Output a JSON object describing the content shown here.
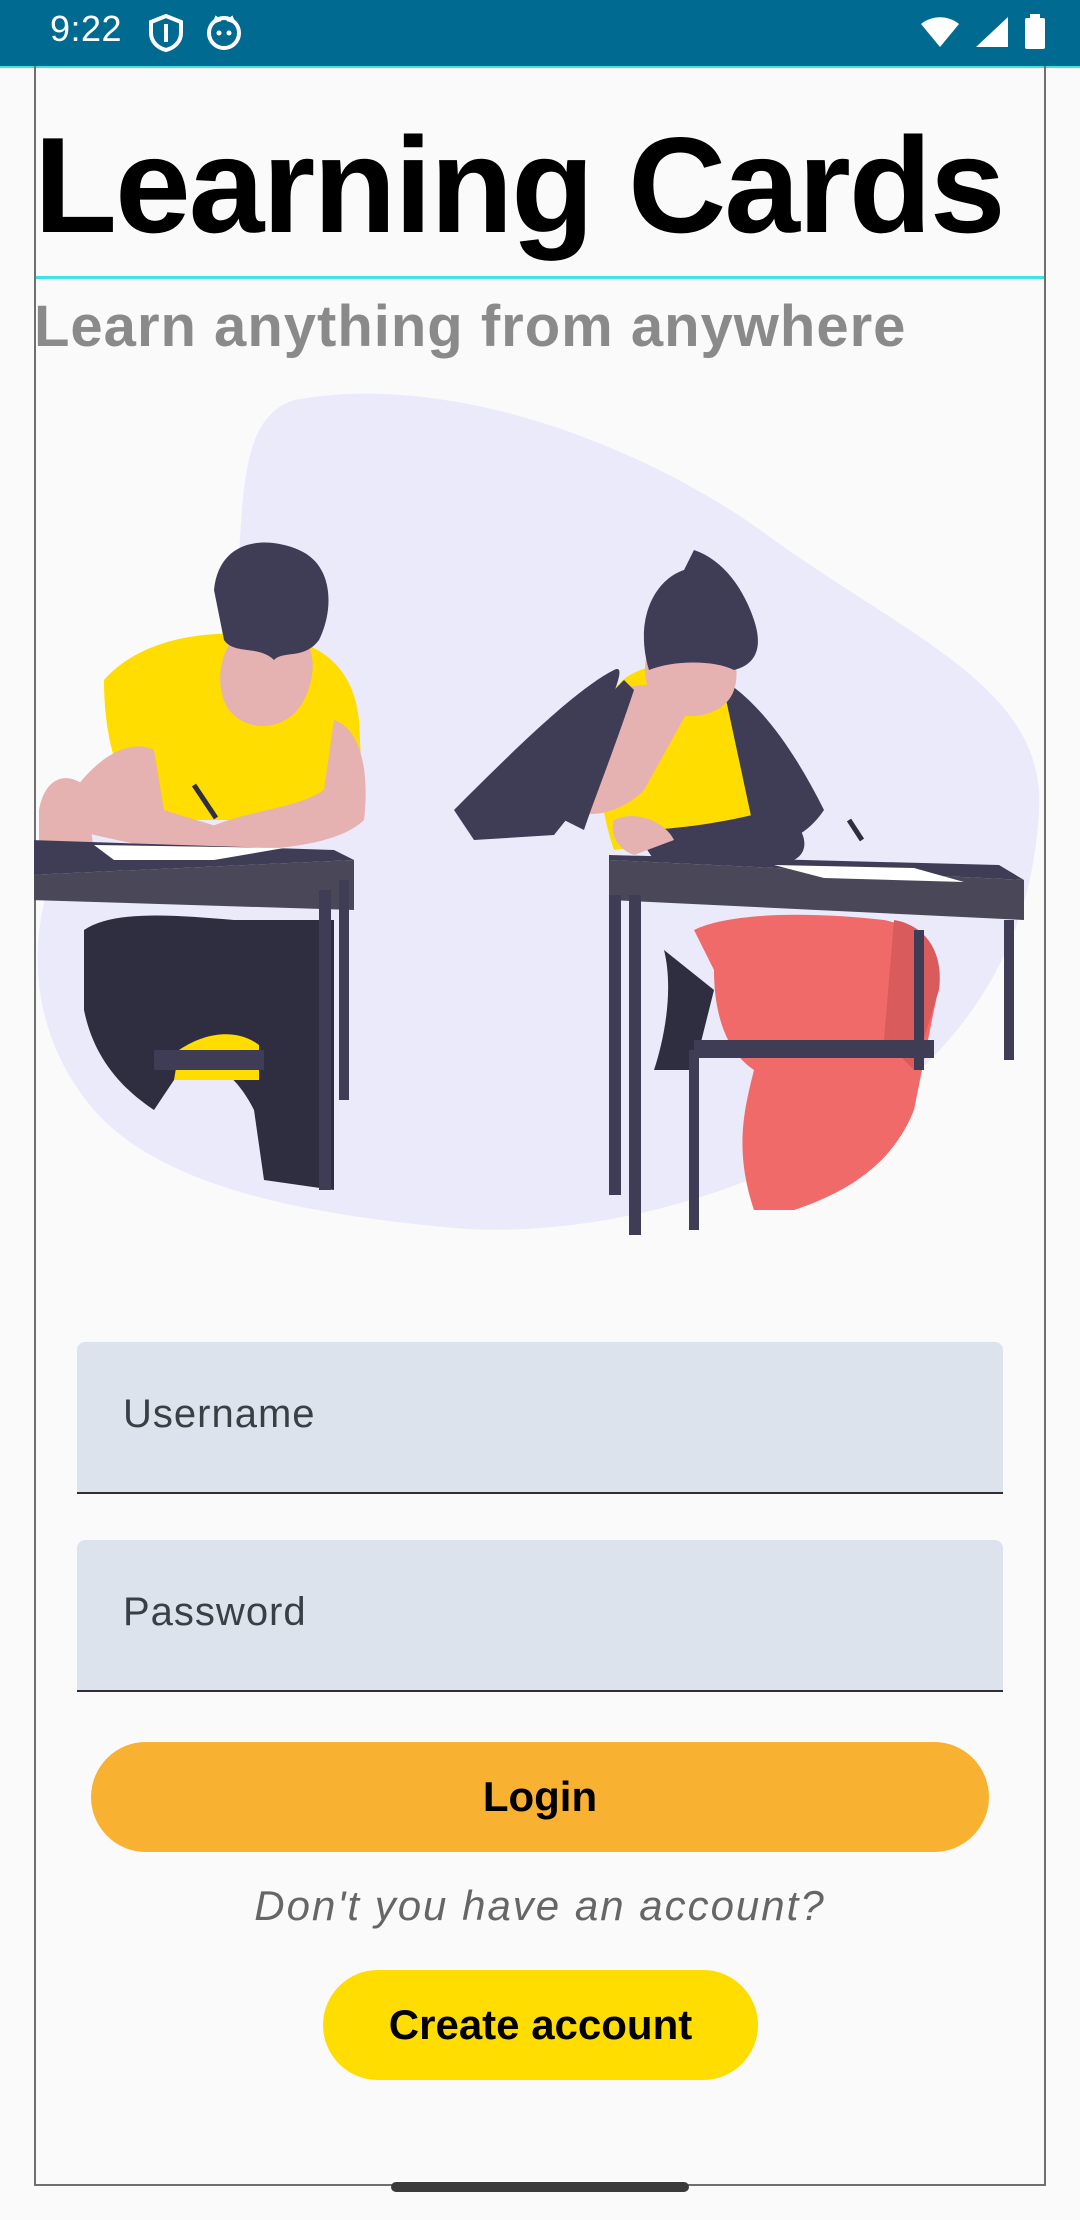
{
  "status_bar": {
    "time": "9:22",
    "left_icons": [
      "shield-icon",
      "cat-icon"
    ],
    "right_icons": [
      "wifi-icon",
      "signal-icon",
      "battery-icon"
    ],
    "background": "#006a91"
  },
  "header": {
    "title": "Learning Cards",
    "subtitle": "Learn anything from anywhere"
  },
  "illustration": {
    "name": "students-studying-illustration"
  },
  "form": {
    "username_placeholder": "Username",
    "password_placeholder": "Password",
    "login_label": "Login",
    "no_account_text": "Don't you have an account?",
    "create_account_label": "Create account"
  },
  "colors": {
    "accent_cyan": "#3ee3e3",
    "login_button": "#f9b132",
    "create_button": "#ffdd00",
    "field_background": "#dde3ec"
  }
}
